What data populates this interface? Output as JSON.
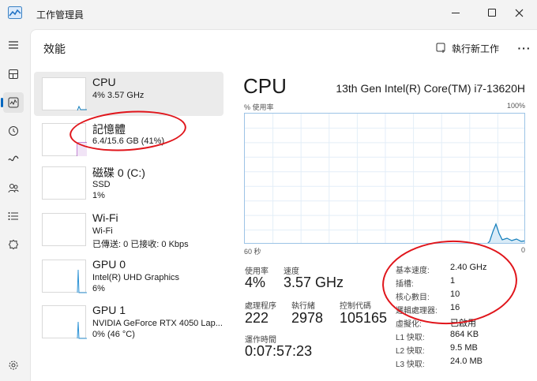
{
  "window": {
    "title": "工作管理員"
  },
  "header": {
    "title": "效能",
    "run_task": "執行新工作"
  },
  "devices": [
    {
      "name": "CPU",
      "line1": "4% 3.57 GHz",
      "line2": ""
    },
    {
      "name": "記憶體",
      "line1": "6.4/15.6 GB (41%)",
      "line2": ""
    },
    {
      "name": "磁碟 0 (C:)",
      "line1": "SSD",
      "line2": "1%"
    },
    {
      "name": "Wi-Fi",
      "line1": "Wi-Fi",
      "line2": "已傳送: 0 已接收: 0 Kbps"
    },
    {
      "name": "GPU 0",
      "line1": "Intel(R) UHD Graphics",
      "line2": "6%"
    },
    {
      "name": "GPU 1",
      "line1": "NVIDIA GeForce RTX 4050 Lap...",
      "line2": "0% (46 °C)"
    }
  ],
  "detail": {
    "title": "CPU",
    "model": "13th Gen Intel(R) Core(TM) i7-13620H",
    "graph": {
      "y_label": "% 使用率",
      "y_max": "100%",
      "x_left": "60 秒",
      "x_right": "0"
    },
    "stats": {
      "utilization_label": "使用率",
      "utilization": "4%",
      "speed_label": "速度",
      "speed": "3.57 GHz",
      "processes_label": "處理程序",
      "processes": "222",
      "threads_label": "執行緒",
      "threads": "2978",
      "handles_label": "控制代碼",
      "handles": "105165",
      "uptime_label": "運作時間",
      "uptime": "0:07:57:23"
    },
    "info": [
      {
        "k": "基本速度:",
        "v": "2.40 GHz"
      },
      {
        "k": "插槽:",
        "v": "1"
      },
      {
        "k": "核心數目:",
        "v": "10"
      },
      {
        "k": "邏輯處理器:",
        "v": "16"
      },
      {
        "k": "虛擬化:",
        "v": "已啟用"
      },
      {
        "k": "L1 快取:",
        "v": "864 KB"
      },
      {
        "k": "L2 快取:",
        "v": "9.5 MB"
      },
      {
        "k": "L3 快取:",
        "v": "24.0 MB"
      }
    ]
  },
  "colors": {
    "cpu": "#117dbb",
    "memory": "#8b12ae",
    "gpu": "#2f94d6",
    "annotation": "#e0151b"
  }
}
